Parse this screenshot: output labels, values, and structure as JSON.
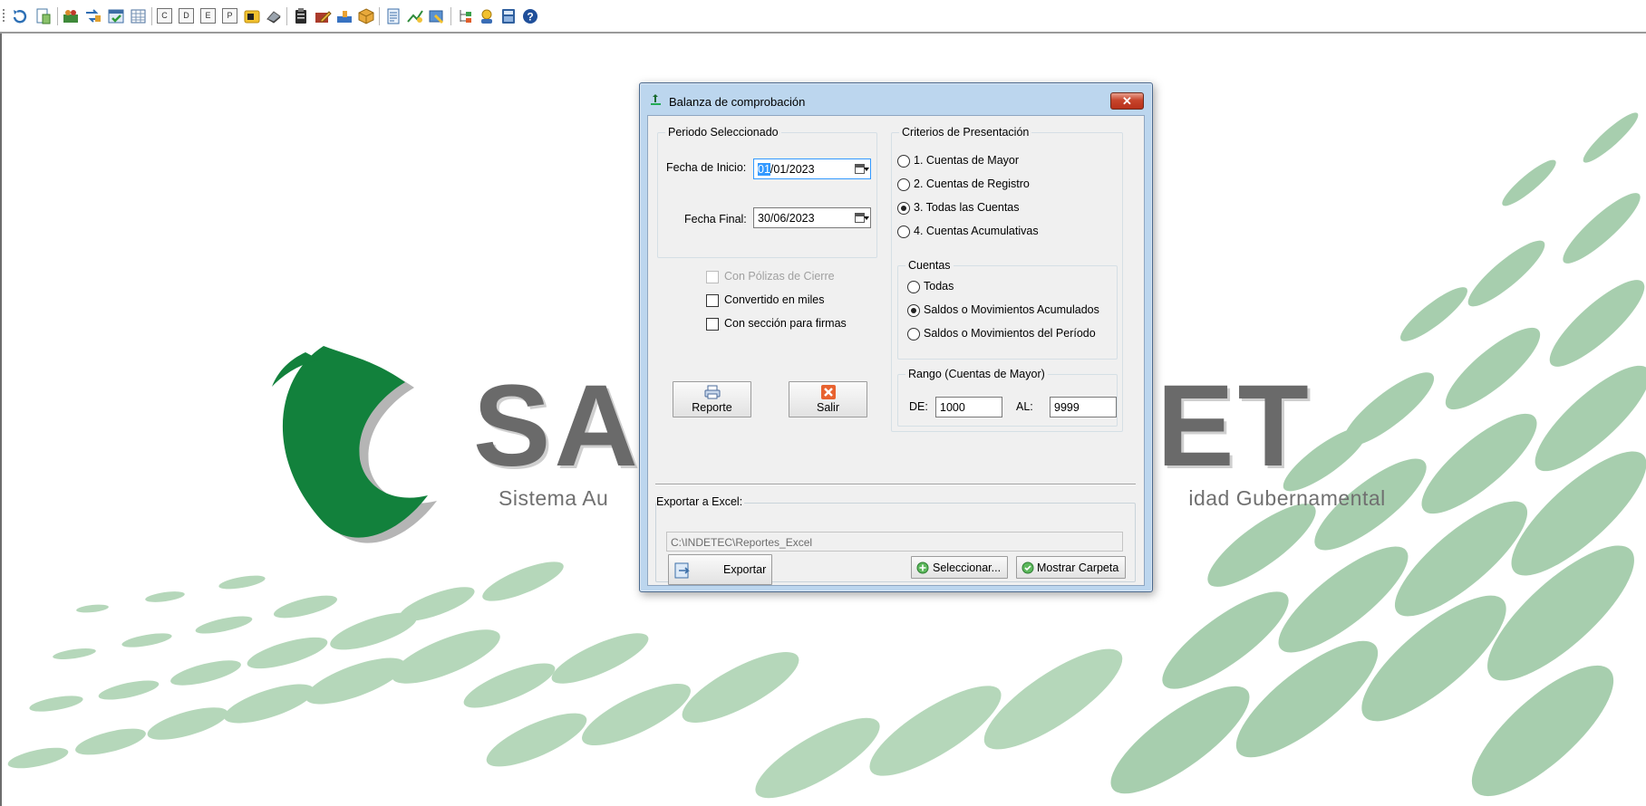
{
  "dialog": {
    "title": "Balanza de comprobación",
    "close_symbol": "✕"
  },
  "periodo": {
    "group_label": "Periodo Seleccionado",
    "fecha_inicio_label": "Fecha de Inicio:",
    "fecha_inicio_selected": "01",
    "fecha_inicio_rest": "/01/2023",
    "fecha_final_label": "Fecha Final:",
    "fecha_final_value": "30/06/2023"
  },
  "options": {
    "polizas_cierre": "Con Pólizas de Cierre",
    "convertido_miles": "Convertido en miles",
    "seccion_firmas": "Con sección para firmas"
  },
  "buttons": {
    "reporte": "Reporte",
    "salir": "Salir",
    "exportar": "Exportar",
    "seleccionar": "Seleccionar...",
    "mostrar_carpeta": "Mostrar Carpeta"
  },
  "criterios": {
    "group_label": "Criterios de Presentación",
    "items": [
      {
        "label": "1. Cuentas de Mayor",
        "checked": false
      },
      {
        "label": "2. Cuentas de Registro",
        "checked": false
      },
      {
        "label": "3. Todas las Cuentas",
        "checked": true
      },
      {
        "label": "4. Cuentas Acumulativas",
        "checked": false
      }
    ]
  },
  "cuentas": {
    "group_label": "Cuentas",
    "items": [
      {
        "label": "Todas",
        "checked": false
      },
      {
        "label": "Saldos o Movimientos Acumulados",
        "checked": true
      },
      {
        "label": "Saldos o Movimientos del Período",
        "checked": false
      }
    ]
  },
  "rango": {
    "group_label": "Rango (Cuentas de Mayor)",
    "de_label": "DE:",
    "de_value": "1000",
    "al_label": "AL:",
    "al_value": "9999"
  },
  "exportar": {
    "label": "Exportar a Excel:",
    "path": "C:\\INDETEC\\Reportes_Excel"
  },
  "background": {
    "brand_visible": "SA NET",
    "brand_left": "SA",
    "brand_right": "NET",
    "subtitle_left": "Sistema Au",
    "subtitle_right": "idad Gubernamental"
  },
  "toolbar": {
    "letter_buttons": [
      "C",
      "D",
      "E",
      "P"
    ]
  },
  "colors": {
    "brand_green": "#12813c",
    "pattern_green": "#9ec9a5",
    "brand_gray": "#6a6a6a",
    "dialog_frame": "#bcd6ee",
    "close_red": "#c7452c"
  }
}
